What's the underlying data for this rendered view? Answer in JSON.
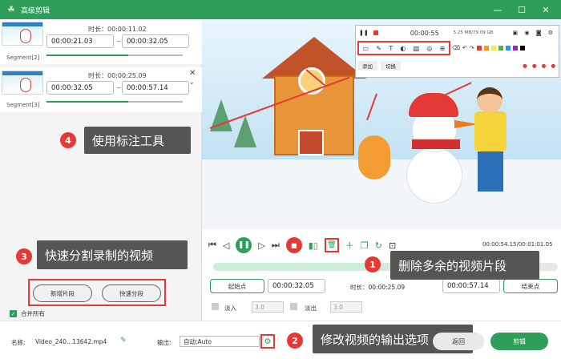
{
  "app": {
    "title": "高级剪辑"
  },
  "window_controls": {
    "minimize": "—",
    "maximize": "☐",
    "close": "✕"
  },
  "segments": [
    {
      "label": "Segment[2]",
      "duration": "时长：00:00:11.02",
      "start": "00:00:21.03",
      "end": "00:00:32.05"
    },
    {
      "label": "Segment[3]",
      "duration": "时长：00:00:25.09",
      "start": "00:00:32.05",
      "end": "00:00:57.14"
    }
  ],
  "callouts": [
    {
      "num": "4",
      "text": "使用标注工具"
    },
    {
      "num": "3",
      "text": "快速分割录制的视频"
    },
    {
      "num": "1",
      "text": "删除多余的视频片段"
    },
    {
      "num": "2",
      "text": "修改视频的输出选项"
    }
  ],
  "split": {
    "new_segment": "新增片段",
    "quick_split": "快速分段"
  },
  "merge": {
    "label": "合并所有",
    "checked": true
  },
  "annotation": {
    "time": "00:00:55",
    "size": "5.25 MB/79.09 GB",
    "tab_a": "添加",
    "tab_b": "切换",
    "colors": [
      "#e53935",
      "#ff9800",
      "#ffeb3b",
      "#4caf50",
      "#2196f3",
      "#9c27b0",
      "#000000",
      "#ffffff"
    ]
  },
  "player": {
    "time": "00:00:54.15/00:01:01.05",
    "timeline_progress": 0.53
  },
  "trim": {
    "start_btn": "起始点",
    "start": "00:00:32.05",
    "duration": "时长：00:00:25.09",
    "end": "00:00:57.14",
    "end_btn": "结束点"
  },
  "fade": {
    "fade_in": "淡入",
    "fade_in_val": "3.0",
    "fade_out": "淡出",
    "fade_out_val": "3.0"
  },
  "bottom": {
    "name_label": "名称:",
    "file_name": "Video_240...13642.mp4",
    "output_label": "输出:",
    "output_value": "自动;Auto",
    "cancel": "返回",
    "edit": "剪辑"
  }
}
